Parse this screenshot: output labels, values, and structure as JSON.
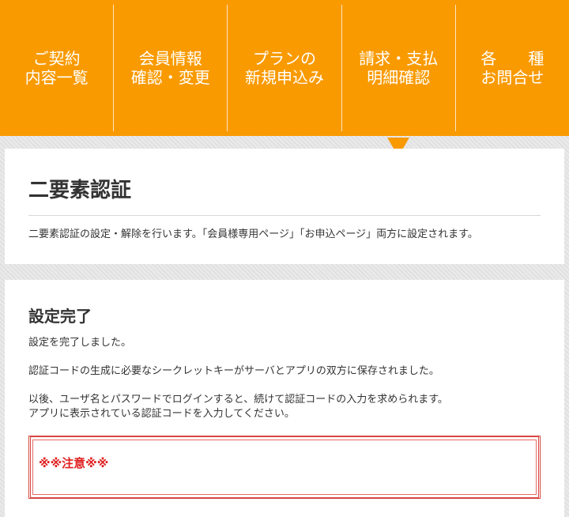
{
  "nav": {
    "items": [
      {
        "label": "ご契約\n内容一覧"
      },
      {
        "label": "会員情報\n確認・変更"
      },
      {
        "label": "プランの\n新規申込み"
      },
      {
        "label": "請求・支払\n明細確認"
      },
      {
        "label": "各　　種\nお問合せ"
      }
    ],
    "active_index": 3
  },
  "header": {
    "title": "二要素認証",
    "intro": "二要素認証の設定・解除を行います。「会員様専用ページ」「お申込ページ」両方に設定されます。"
  },
  "main": {
    "section_title": "設定完了",
    "paragraphs": [
      "設定を完了しました。",
      "認証コードの生成に必要なシークレットキーがサーバとアプリの双方に保存されました。",
      "以後、ユーザ名とパスワードでログインすると、続けて認証コードの入力を求められます。\nアプリに表示されている認証コードを入力してください。"
    ],
    "notice_title": "※※注意※※"
  },
  "colors": {
    "accent": "#f99a00",
    "notice_red": "#e02020"
  }
}
